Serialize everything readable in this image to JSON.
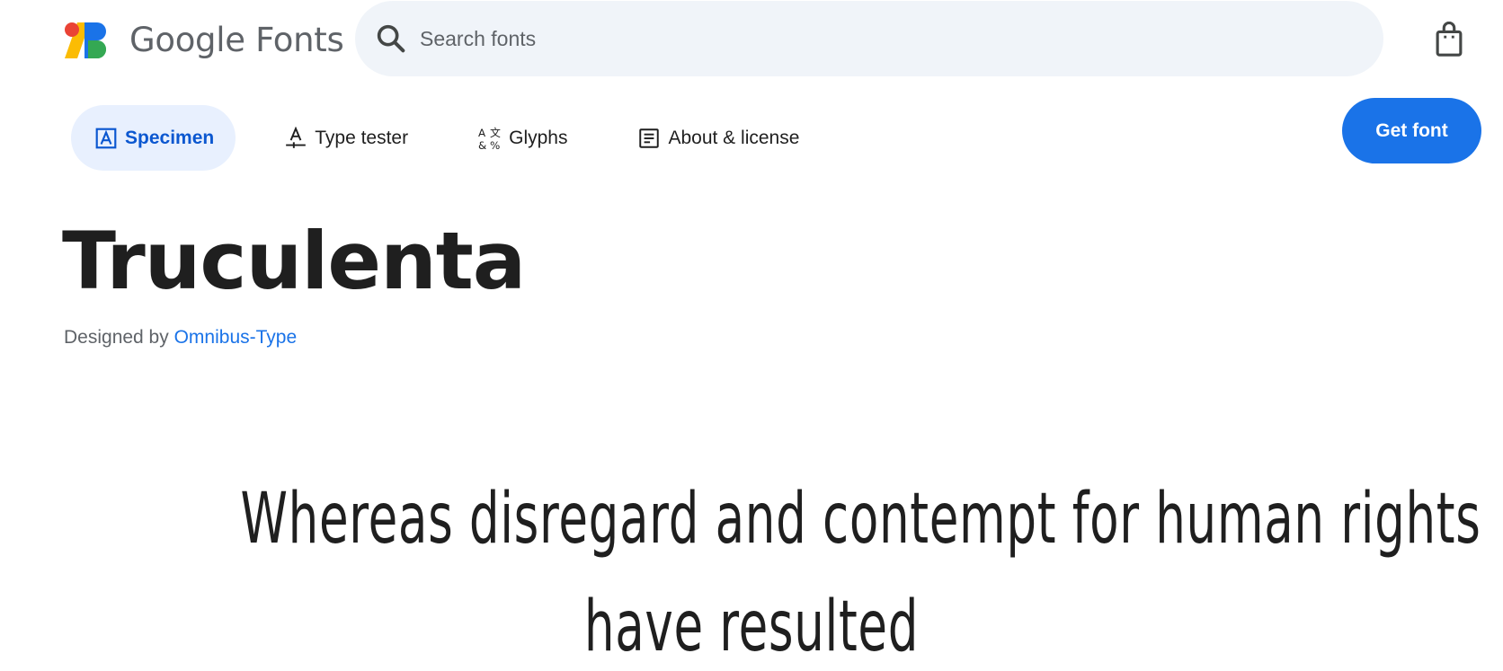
{
  "header": {
    "logo_text": "Google Fonts",
    "search": {
      "placeholder": "Search fonts",
      "value": ""
    },
    "bag_icon": "shopping-bag-icon"
  },
  "tabs": [
    {
      "label": "Specimen",
      "icon": "specimen-icon",
      "active": true
    },
    {
      "label": "Type tester",
      "icon": "type-tester-icon",
      "active": false
    },
    {
      "label": "Glyphs",
      "icon": "glyphs-icon",
      "active": false
    },
    {
      "label": "About & license",
      "icon": "article-icon",
      "active": false
    }
  ],
  "get_font_label": "Get font",
  "font": {
    "name": "Truculenta",
    "designed_by_prefix": "Designed by",
    "designer": "Omnibus-Type"
  },
  "preview": {
    "line1": "Whereas disregard and contempt for human rights",
    "line2": "have resulted"
  },
  "colors": {
    "accent": "#1a73e8",
    "active_tab_bg": "#e8f0fe",
    "active_tab_text": "#0b57d0",
    "search_bg": "#f0f4f9"
  }
}
